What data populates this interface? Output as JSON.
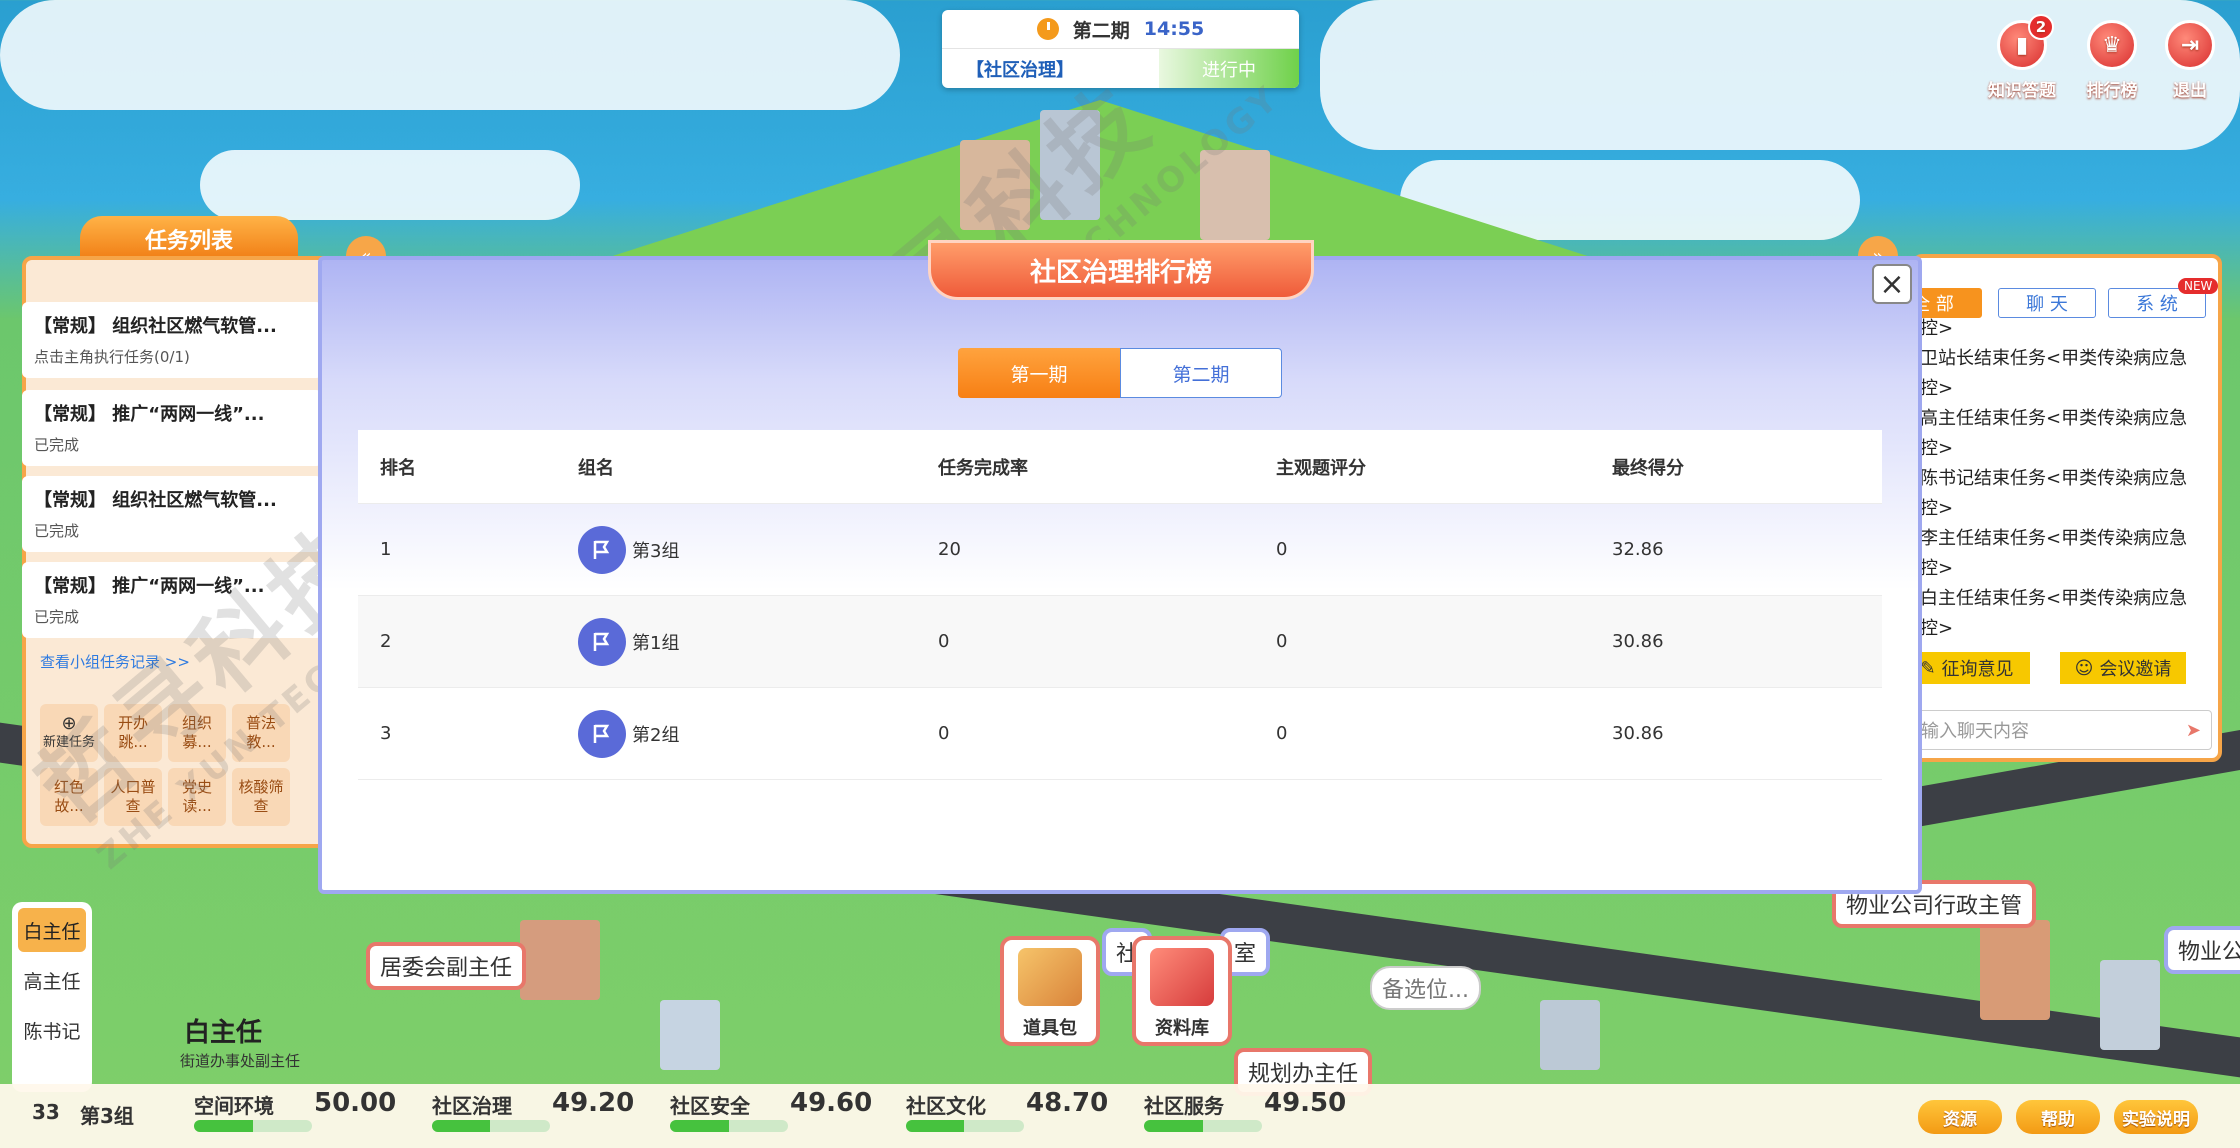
{
  "top": {
    "period": "第二期",
    "time": "14:55",
    "phase": "【社区治理】",
    "status": "进行中",
    "buttons": [
      {
        "label": "知识答题",
        "badge": "2"
      },
      {
        "label": "排行榜"
      },
      {
        "label": "退出"
      }
    ]
  },
  "tasks": {
    "title": "任务列表",
    "items": [
      {
        "title": "【常规】 组织社区燃气软管...",
        "status": "点击主角执行任务(0/1)"
      },
      {
        "title": "【常规】 推广“两网一线”...",
        "status": "已完成"
      },
      {
        "title": "【常规】 组织社区燃气软管...",
        "status": "已完成"
      },
      {
        "title": "【常规】 推广“两网一线”...",
        "status": "已完成"
      }
    ],
    "record_link": "查看小组任务记录 >>",
    "new_task": "新建任务",
    "quick": [
      "开办跳...",
      "组织募...",
      "普法教...",
      "红色故...",
      "人口普查",
      "党史读...",
      "核酸筛查"
    ]
  },
  "roles": [
    "白主任",
    "高主任",
    "陈书记"
  ],
  "player": {
    "name": "白主任",
    "title": "街道办事处副主任"
  },
  "chat": {
    "tabs": [
      "全 部",
      "聊 天",
      "系 统"
    ],
    "new": "NEW",
    "messages": [
      "控>",
      "卫站长结束任务<甲类传染病应急控>",
      "高主任结束任务<甲类传染病应急控>",
      "陈书记结束任务<甲类传染病应急控>",
      "李主任结束任务<甲类传染病应急控>",
      "白主任结束任务<甲类传染病应急控>"
    ],
    "actions": [
      "征询意见",
      "会议邀请"
    ],
    "input_placeholder": "输入聊天内容"
  },
  "map_labels": {
    "vice_director": "居委会副主任",
    "property_admin": "物业公司行政主管",
    "property_short": "物业公",
    "planning": "规划办主任",
    "candidate": "备选位...",
    "office": "社",
    "office_end": "室",
    "tools": [
      "道具包",
      "资料库"
    ]
  },
  "bottom": {
    "group_no": "33",
    "group_name": "第3组",
    "stats": [
      {
        "name": "空间环境",
        "value": "50.00",
        "fill": 0.5
      },
      {
        "name": "社区治理",
        "value": "49.20",
        "fill": 0.49
      },
      {
        "name": "社区安全",
        "value": "49.60",
        "fill": 0.5
      },
      {
        "name": "社区文化",
        "value": "48.70",
        "fill": 0.49
      },
      {
        "name": "社区服务",
        "value": "49.50",
        "fill": 0.5
      }
    ],
    "buttons": [
      "资源",
      "帮助",
      "实验说明"
    ]
  },
  "modal": {
    "title": "社区治理排行榜",
    "tabs": [
      "第一期",
      "第二期"
    ],
    "headers": [
      "排名",
      "组名",
      "任务完成率",
      "主观题评分",
      "最终得分"
    ],
    "rows": [
      {
        "rank": "1",
        "group": "第3组",
        "rate": "20",
        "score": "0",
        "final": "32.86"
      },
      {
        "rank": "2",
        "group": "第1组",
        "rate": "0",
        "score": "0",
        "final": "30.86"
      },
      {
        "rank": "3",
        "group": "第2组",
        "rate": "0",
        "score": "0",
        "final": "30.86"
      }
    ]
  },
  "watermark": {
    "cn": "哲寻科技",
    "en": "ZHE XUN TECHNOLOGY"
  }
}
